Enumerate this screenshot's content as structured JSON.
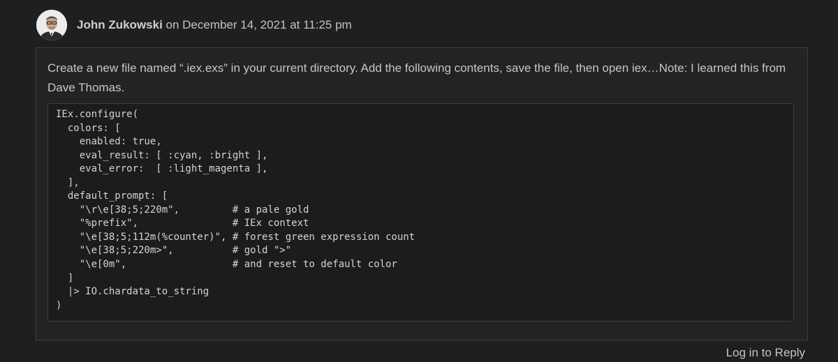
{
  "comment": {
    "author": "John Zukowski",
    "date_text": " on December 14, 2021 at 11:25 pm",
    "text": "Create a new file named “.iex.exs” in your current directory. Add the following contents, save the file, then open iex…Note: I learned this from Dave Thomas.",
    "code_lines": [
      "IEx.configure(",
      "  colors: [",
      "    enabled: true,",
      "    eval_result: [ :cyan, :bright ],",
      "    eval_error:  [ :light_magenta ],",
      "  ],",
      "  default_prompt: [",
      "    \"\\r\\e[38;5;220m\",         # a pale gold",
      "    \"%prefix\",                # IEx context",
      "    \"\\e[38;5;112m(%counter)\", # forest green expression count",
      "    \"\\e[38;5;220m>\",          # gold \">\"",
      "    \"\\e[0m\",                  # and reset to default color",
      "  ]",
      "  |> IO.chardata_to_string",
      ")"
    ],
    "reply_label": "Log in to Reply"
  },
  "colors": {
    "background": "#1e1f20",
    "box_border": "#3f4042",
    "code_background": "#1b1c1d"
  }
}
